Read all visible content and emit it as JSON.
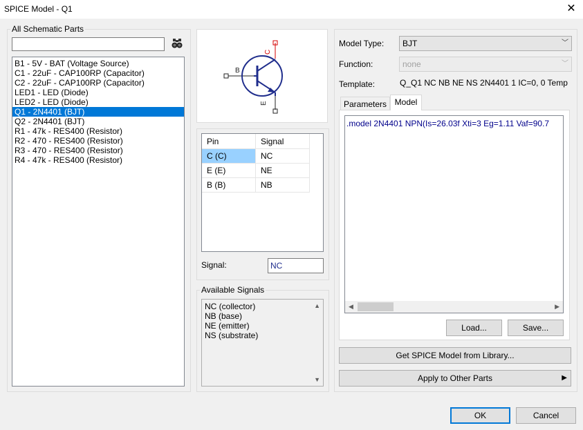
{
  "window": {
    "title": "SPICE Model - Q1",
    "close_glyph": "✕"
  },
  "parts": {
    "label": "All Schematic Parts",
    "search_value": "",
    "items": [
      "B1 - 5V - BAT (Voltage Source)",
      "C1 - 22uF - CAP100RP (Capacitor)",
      "C2 - 22uF - CAP100RP (Capacitor)",
      "LED1 - LED (Diode)",
      "LED2 - LED (Diode)",
      "Q1 - 2N4401 (BJT)",
      "Q2 - 2N4401 (BJT)",
      "R1 - 47k - RES400 (Resistor)",
      "R2 - 470 - RES400 (Resistor)",
      "R3 - 470 - RES400 (Resistor)",
      "R4 - 47k - RES400 (Resistor)"
    ],
    "selected_index": 5
  },
  "symbol": {
    "pin_c": "C",
    "pin_b": "B",
    "pin_e": "E",
    "stroke": "#1f2d8c",
    "lead": "#d40000"
  },
  "pins": {
    "headers": [
      "Pin",
      "Signal"
    ],
    "rows": [
      {
        "pin": "C (C)",
        "signal": "NC"
      },
      {
        "pin": "E (E)",
        "signal": "NE"
      },
      {
        "pin": "B (B)",
        "signal": "NB"
      }
    ],
    "signal_label": "Signal:",
    "signal_value": "NC"
  },
  "available": {
    "label": "Available Signals",
    "items": [
      "NC (collector)",
      "NB (base)",
      "NE (emitter)",
      "NS (substrate)"
    ]
  },
  "model": {
    "type_label": "Model Type:",
    "type_value": "BJT",
    "function_label": "Function:",
    "function_value": "none",
    "template_label": "Template:",
    "template_value": "Q_Q1 NC NB NE NS 2N4401 1 IC=0, 0 Temp",
    "tabs": [
      "Parameters",
      "Model"
    ],
    "active_tab": 1,
    "text": ".model 2N4401 NPN(Is=26.03f Xti=3 Eg=1.11 Vaf=90.7",
    "text_color": "#00008b",
    "load_btn": "Load...",
    "save_btn": "Save..."
  },
  "actions": {
    "get_library": "Get SPICE Model from Library...",
    "apply_other": "Apply to Other Parts",
    "ok": "OK",
    "cancel": "Cancel"
  }
}
